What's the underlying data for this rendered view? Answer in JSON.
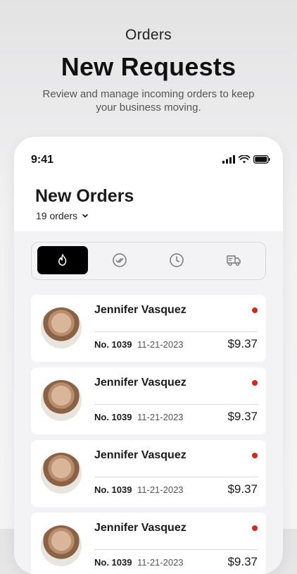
{
  "hero": {
    "eyebrow": "Orders",
    "title": "New Requests",
    "subtitle": "Review and manage incoming orders to keep your business moving."
  },
  "status_bar": {
    "time": "9:41",
    "icons": [
      "signal-icon",
      "wifi-icon",
      "battery-icon"
    ]
  },
  "header": {
    "title": "New Orders",
    "count": "19 orders"
  },
  "tabs": [
    {
      "name": "new",
      "icon": "flame-icon",
      "active": true
    },
    {
      "name": "accepted",
      "icon": "double-check-icon",
      "active": false
    },
    {
      "name": "pending",
      "icon": "clock-icon",
      "active": false
    },
    {
      "name": "delivery",
      "icon": "truck-icon",
      "active": false
    }
  ],
  "orders": [
    {
      "name": "Jennifer Vasquez",
      "number": "No. 1039",
      "date": "11-21-2023",
      "price": "$9.37"
    },
    {
      "name": "Jennifer Vasquez",
      "number": "No. 1039",
      "date": "11-21-2023",
      "price": "$9.37"
    },
    {
      "name": "Jennifer Vasquez",
      "number": "No. 1039",
      "date": "11-21-2023",
      "price": "$9.37"
    },
    {
      "name": "Jennifer Vasquez",
      "number": "No. 1039",
      "date": "11-21-2023",
      "price": "$9.37"
    }
  ],
  "colors": {
    "accent": "#000000",
    "unread_dot": "#d2291d",
    "background": "#f3f3f5"
  }
}
